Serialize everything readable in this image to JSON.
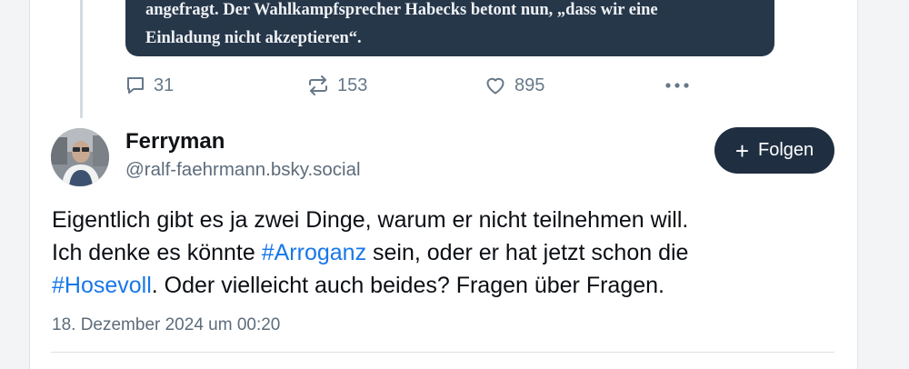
{
  "quoted_post": {
    "line1": "angefragt. Der Wahlkampfsprecher Habecks betont nun, „dass wir eine",
    "line2": "Einladung nicht akzeptieren“."
  },
  "actions": {
    "reply_count": "31",
    "repost_count": "153",
    "like_count": "895",
    "reply_icon": "speech-bubble-icon",
    "repost_icon": "repost-arrows-icon",
    "like_icon": "heart-icon",
    "more_icon": "ellipsis-icon"
  },
  "post": {
    "author_name": "Ferryman",
    "author_handle": "@ralf-faehrmann.bsky.social",
    "follow_label": "Folgen",
    "follow_icon": "plus-icon",
    "text_line1": "Eigentlich gibt es ja zwei Dinge, warum er nicht teilnehmen will.",
    "text_line2_before": "Ich denke es könnte ",
    "hashtag1": "#Arroganz",
    "text_line2_after": " sein, oder er hat jetzt schon die",
    "hashtag2": "#Hosevoll",
    "text_line3_after": ". Oder vielleicht auch beides? Fragen über Fragen.",
    "timestamp": "18. Dezember 2024 um 00:20"
  },
  "colors": {
    "accent_link": "#1877e8",
    "follow_button_bg": "#1f2f41",
    "quote_bg": "#27374a",
    "muted_text": "#5d6c7b"
  }
}
